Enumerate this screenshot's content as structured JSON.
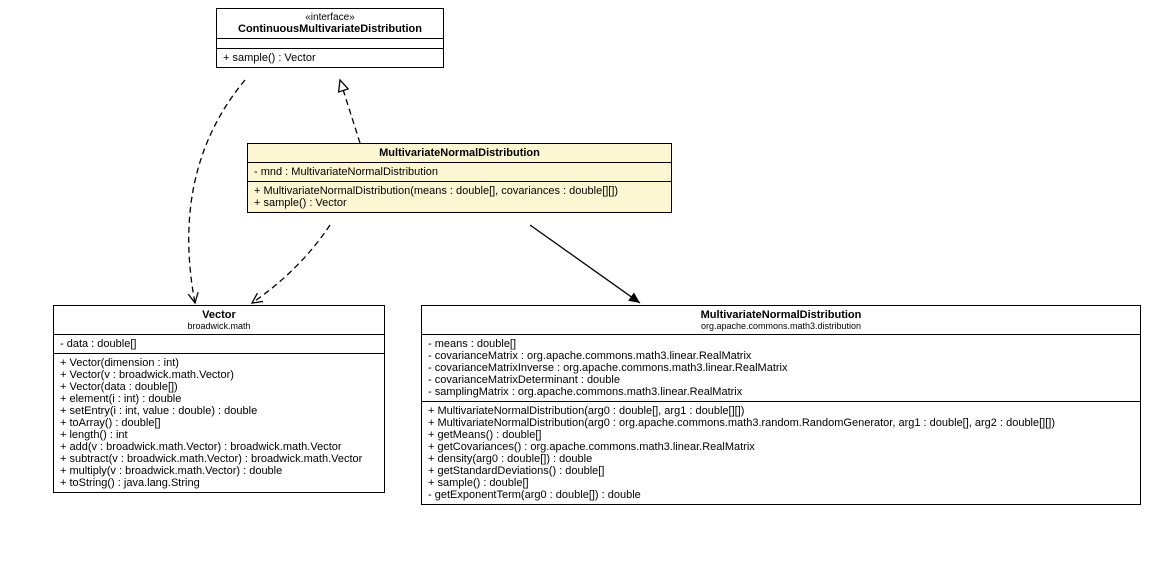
{
  "interface": {
    "stereotype": "«interface»",
    "name": "ContinuousMultivariateDistribution",
    "methods": "+ sample() : Vector"
  },
  "mnd": {
    "name": "MultivariateNormalDistribution",
    "attrs": "- mnd : MultivariateNormalDistribution",
    "methods": "+ MultivariateNormalDistribution(means : double[], covariances : double[][])\n+ sample() : Vector"
  },
  "vector": {
    "name": "Vector",
    "pkg": "broadwick.math",
    "attrs": "- data : double[]",
    "methods": "+ Vector(dimension : int)\n+ Vector(v : broadwick.math.Vector)\n+ Vector(data : double[])\n+ element(i : int) : double\n+ setEntry(i : int, value : double) : double\n+ toArray() : double[]\n+ length() : int\n+ add(v : broadwick.math.Vector) : broadwick.math.Vector\n+ subtract(v : broadwick.math.Vector) : broadwick.math.Vector\n+ multiply(v : broadwick.math.Vector) : double\n+ toString() : java.lang.String"
  },
  "apache": {
    "name": "MultivariateNormalDistribution",
    "pkg": "org.apache.commons.math3.distribution",
    "attrs": "- means : double[]\n- covarianceMatrix : org.apache.commons.math3.linear.RealMatrix\n- covarianceMatrixInverse : org.apache.commons.math3.linear.RealMatrix\n- covarianceMatrixDeterminant : double\n- samplingMatrix : org.apache.commons.math3.linear.RealMatrix",
    "methods": "+ MultivariateNormalDistribution(arg0 : double[], arg1 : double[][])\n+ MultivariateNormalDistribution(arg0 : org.apache.commons.math3.random.RandomGenerator, arg1 : double[], arg2 : double[][])\n+ getMeans() : double[]\n+ getCovariances() : org.apache.commons.math3.linear.RealMatrix\n+ density(arg0 : double[]) : double\n+ getStandardDeviations() : double[]\n+ sample() : double[]\n- getExponentTerm(arg0 : double[]) : double"
  }
}
